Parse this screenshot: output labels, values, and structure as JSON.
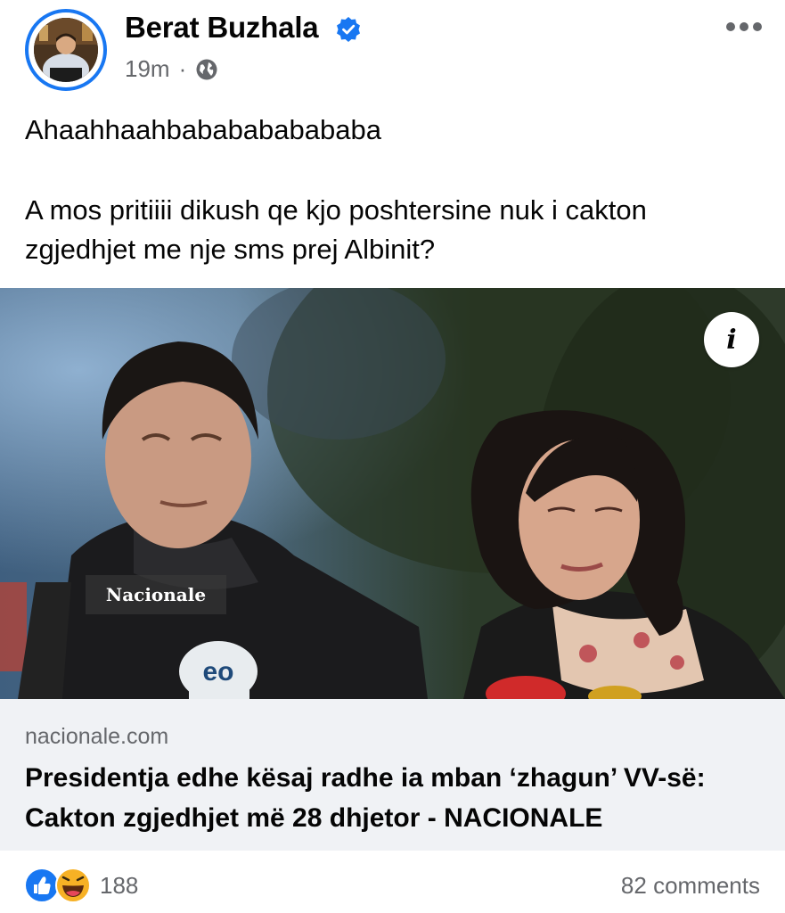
{
  "post": {
    "author": "Berat Buzhala",
    "time": "19m",
    "separator": "·",
    "text_line1": "Ahaahhaahbababababababa",
    "text_line2": "A mos pritiiii dikush qe kjo poshtersine nuk i cakton zgjedhjet me nje sms prej Albinit?"
  },
  "media": {
    "watermark": "Nacionale",
    "mic_label": "eo",
    "info_glyph": "i"
  },
  "link": {
    "domain": "nacionale.com",
    "headline": "Presidentja edhe kësaj radhe ia mban ‘zhagun’ VV-së: Cakton zgjedhjet më 28 dhjetor - NACIONALE"
  },
  "footer": {
    "reaction_count": "188",
    "comments": "82 comments"
  },
  "icons": {
    "verified": "verified-badge-icon",
    "privacy": "globe-icon",
    "menu": "more-options-icon",
    "reactions": [
      "like-icon",
      "haha-icon"
    ]
  },
  "colors": {
    "brand_blue": "#1877f2",
    "secondary_text": "#65676b",
    "link_bg": "#f0f2f5"
  }
}
